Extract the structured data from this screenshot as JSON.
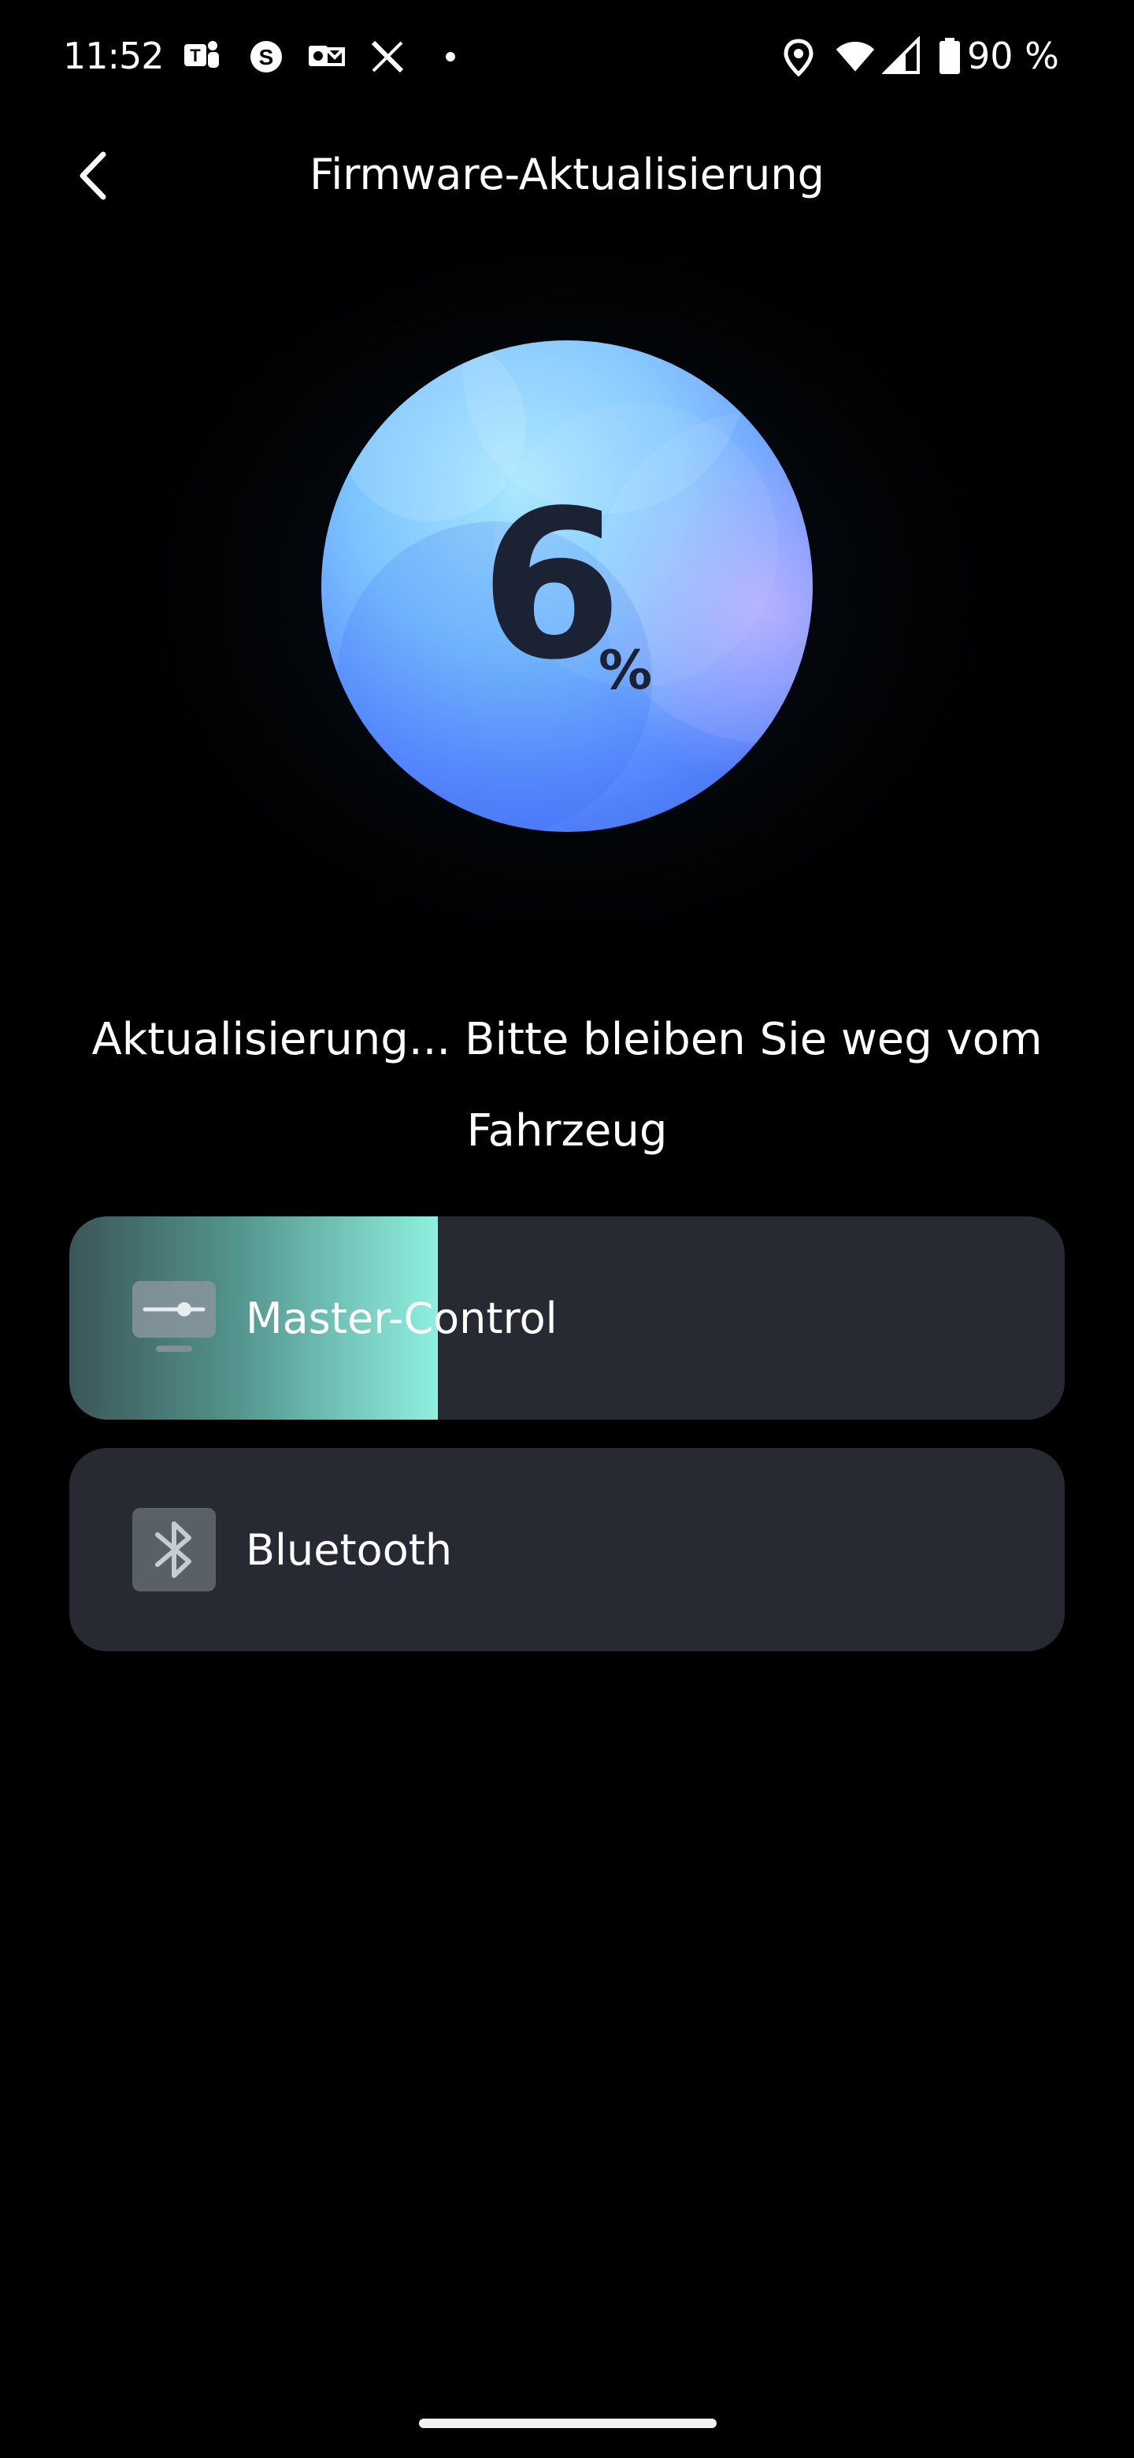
{
  "status_bar": {
    "time": "11:52",
    "battery_text": "90 %",
    "icons": [
      "teams-icon",
      "skype-icon",
      "outlook-icon",
      "x-icon",
      "dot-icon",
      "location-icon",
      "wifi-icon",
      "signal-icon",
      "battery-icon"
    ]
  },
  "app_bar": {
    "title": "Firmware-Aktualisierung"
  },
  "progress": {
    "value": "6",
    "unit": "%",
    "fraction": 0.06
  },
  "message": "Aktualisierung... Bitte bleiben Sie weg vom Fahrzeug",
  "modules": [
    {
      "label": "Master-Control",
      "icon": "slider-monitor-icon",
      "progress_fraction": 0.37
    },
    {
      "label": "Bluetooth",
      "icon": "bluetooth-icon"
    }
  ],
  "colors": {
    "background": "#000000",
    "card": "#272a33",
    "progress_accent": "#8ef0df",
    "orb_light": "#9fe0ff",
    "orb_dark": "#4f7dff",
    "number": "#1a2233"
  }
}
